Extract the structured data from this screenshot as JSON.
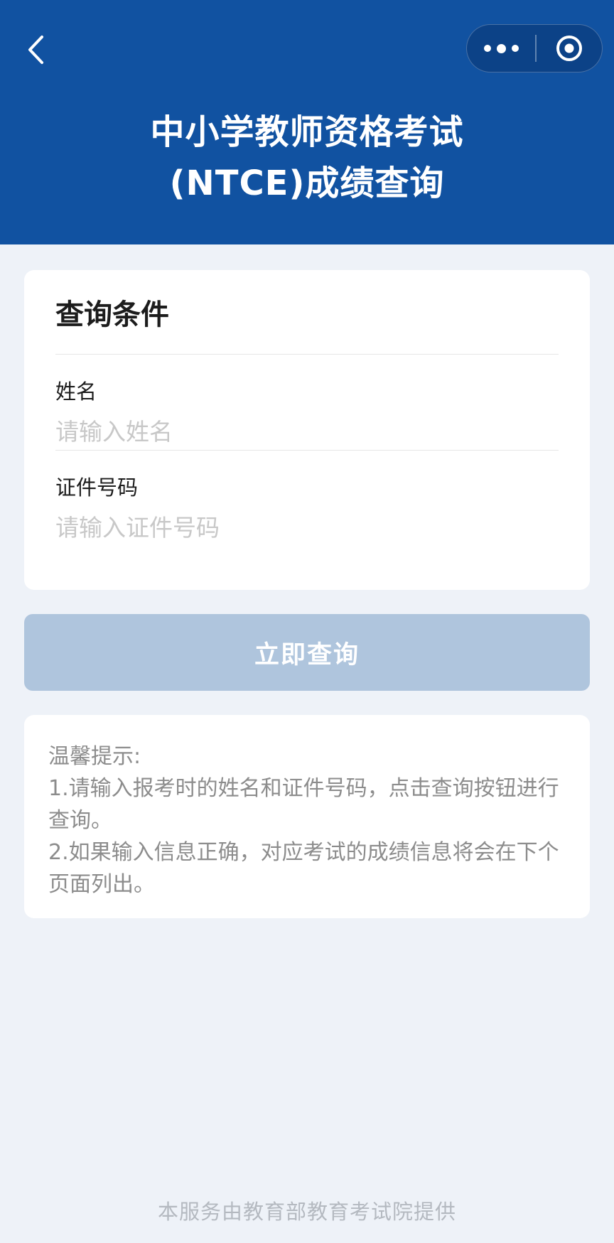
{
  "header": {
    "title_line1": "中小学教师资格考试",
    "title_line2": "(NTCE)成绩查询",
    "back_icon": "chevron-left-icon",
    "more_icon": "more-dots-icon",
    "close_icon": "target-circle-icon",
    "background_color": "#1152A1"
  },
  "form": {
    "section_title": "查询条件",
    "name_label": "姓名",
    "name_placeholder": "请输入姓名",
    "name_value": "",
    "id_label": "证件号码",
    "id_placeholder": "请输入证件号码",
    "id_value": ""
  },
  "submit": {
    "label": "立即查询",
    "color": "#AFC5DD",
    "state": "disabled-looking"
  },
  "tips": {
    "title": "温馨提示:",
    "line1": "1.请输入报考时的姓名和证件号码，点击查询按钮进行查询。",
    "line2": "2.如果输入信息正确，对应考试的成绩信息将会在下个页面列出。"
  },
  "footer": {
    "text": "本服务由教育部教育考试院提供"
  }
}
